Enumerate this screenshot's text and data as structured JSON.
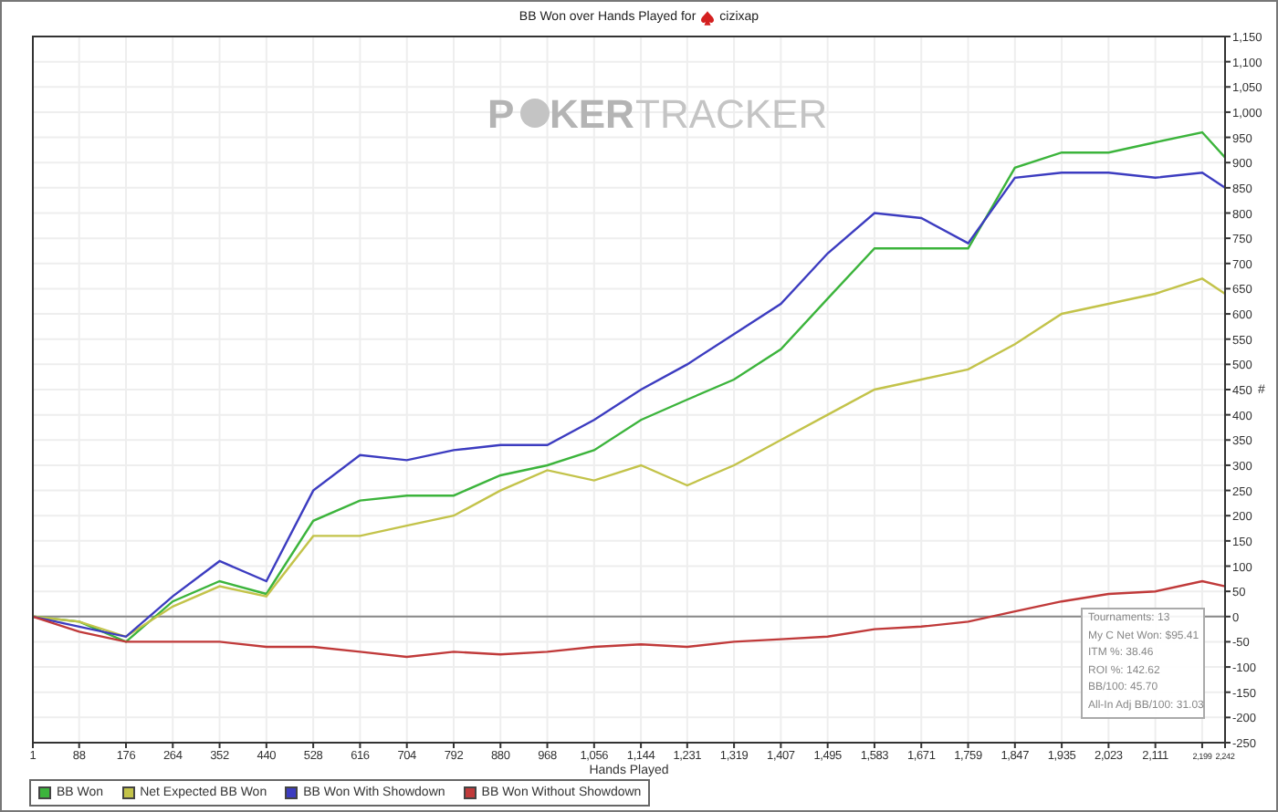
{
  "title": {
    "text": "BB Won over Hands Played for",
    "player": "cizixap"
  },
  "watermark": {
    "first": "P",
    "middle": "KER",
    "last": "TRACKER"
  },
  "chart_data": {
    "type": "line",
    "grid": true,
    "xlabel": "Hands Played",
    "ylabel": "#",
    "xlim": [
      1,
      2242
    ],
    "ylim": [
      -250,
      1150
    ],
    "x": [
      1,
      88,
      176,
      264,
      352,
      440,
      528,
      616,
      704,
      792,
      880,
      968,
      1056,
      1144,
      1231,
      1319,
      1407,
      1495,
      1583,
      1671,
      1759,
      1847,
      1935,
      2023,
      2111,
      2199,
      2242
    ],
    "xticks": [
      1,
      88,
      176,
      264,
      352,
      440,
      528,
      616,
      704,
      792,
      880,
      968,
      {
        "value": 1056,
        "label": "1,056"
      },
      {
        "value": 1144,
        "label": "1,144"
      },
      {
        "value": 1231,
        "label": "1,231"
      },
      {
        "value": 1319,
        "label": "1,319"
      },
      {
        "value": 1407,
        "label": "1,407"
      },
      {
        "value": 1495,
        "label": "1,495"
      },
      {
        "value": 1583,
        "label": "1,583"
      },
      {
        "value": 1671,
        "label": "1,671"
      },
      {
        "value": 1759,
        "label": "1,759"
      },
      {
        "value": 1847,
        "label": "1,847"
      },
      {
        "value": 1935,
        "label": "1,935"
      },
      {
        "value": 2023,
        "label": "2,023"
      },
      {
        "value": 2111,
        "label": "2,111"
      },
      {
        "value": 2199,
        "label": "2,199"
      },
      {
        "value": 2242,
        "label": "2,242"
      }
    ],
    "yticks": [
      -250,
      -200,
      -150,
      -100,
      -50,
      0,
      50,
      100,
      150,
      200,
      250,
      300,
      350,
      400,
      450,
      500,
      550,
      600,
      650,
      700,
      750,
      800,
      850,
      900,
      950,
      {
        "value": 1000,
        "label": "1,000"
      },
      {
        "value": 1050,
        "label": "1,050"
      },
      {
        "value": 1100,
        "label": "1,100"
      },
      {
        "value": 1150,
        "label": "1,150"
      }
    ],
    "series": [
      {
        "name": "BB Won",
        "color": "#3cb43c",
        "values": [
          0,
          -10,
          -50,
          30,
          70,
          45,
          190,
          230,
          240,
          240,
          280,
          300,
          330,
          390,
          430,
          470,
          530,
          630,
          730,
          730,
          730,
          890,
          920,
          920,
          940,
          960,
          910
        ]
      },
      {
        "name": "Net Expected BB Won",
        "color": "#c3c34a",
        "values": [
          0,
          -10,
          -40,
          20,
          60,
          40,
          160,
          160,
          180,
          200,
          250,
          290,
          270,
          300,
          260,
          300,
          350,
          400,
          450,
          470,
          490,
          540,
          600,
          620,
          640,
          670,
          640
        ]
      },
      {
        "name": "BB Won With Showdown",
        "color": "#3c3cc0",
        "values": [
          0,
          -20,
          -40,
          40,
          110,
          70,
          250,
          320,
          310,
          330,
          340,
          340,
          390,
          450,
          500,
          560,
          620,
          720,
          800,
          790,
          740,
          870,
          880,
          880,
          870,
          880,
          850
        ]
      },
      {
        "name": "BB Won Without Showdown",
        "color": "#c03a3a",
        "values": [
          0,
          -30,
          -50,
          -50,
          -50,
          -60,
          -60,
          -70,
          -80,
          -70,
          -75,
          -70,
          -60,
          -55,
          -60,
          -50,
          -45,
          -40,
          -25,
          -20,
          -10,
          10,
          30,
          45,
          50,
          70,
          60
        ]
      }
    ]
  },
  "stats": [
    "Tournaments: 13",
    "My C Net Won: $95.41",
    "ITM %: 38.46",
    "ROI %: 142.62",
    "BB/100: 45.70",
    "All-In Adj BB/100: 31.03"
  ]
}
